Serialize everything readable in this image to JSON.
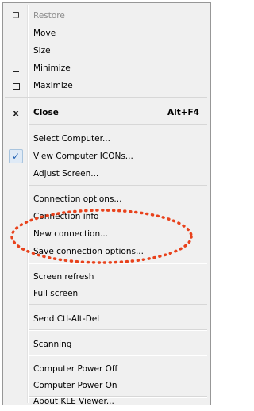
{
  "menu": {
    "restore": "Restore",
    "move": "Move",
    "size": "Size",
    "minimize": "Minimize",
    "maximize": "Maximize",
    "close": "Close",
    "close_shortcut": "Alt+F4",
    "select_computer": "Select Computer...",
    "view_computer_icons": "View Computer ICONs...",
    "adjust_screen": "Adjust Screen...",
    "connection_options": "Connection options...",
    "connection_info": "Connection info",
    "new_connection": "New connection...",
    "save_connection_options": "Save connection options...",
    "screen_refresh": "Screen refresh",
    "full_screen": "Full screen",
    "send_ctl_alt_del": "Send Ctl-Alt-Del",
    "scanning": "Scanning",
    "computer_power_off": "Computer Power Off",
    "computer_power_on": "Computer Power On",
    "about": "About KLE Viewer..."
  },
  "icons": {
    "restore": "restore-icon",
    "minimize": "minimize-icon",
    "maximize": "maximize-icon",
    "close": "close-icon",
    "check": "checkmark-icon"
  },
  "colors": {
    "annotation": "#e8421c",
    "check": "#1f5fb2"
  }
}
